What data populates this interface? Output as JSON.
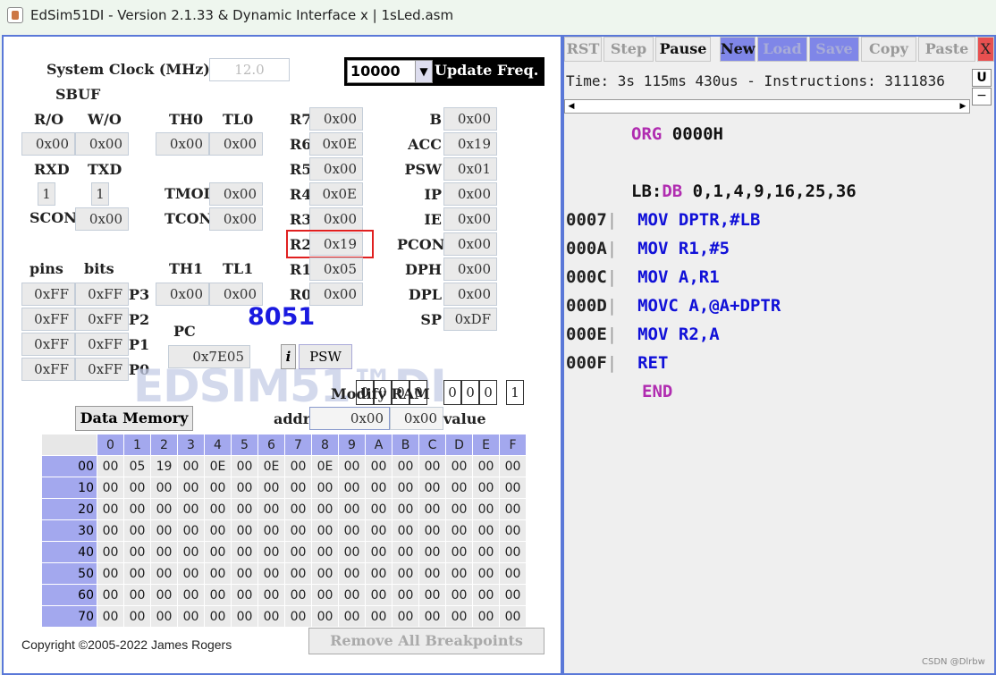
{
  "window": {
    "title": "EdSim51DI - Version 2.1.33 & Dynamic Interface x | 1sLed.asm"
  },
  "top": {
    "system_clock_label": "System Clock (MHz)",
    "system_clock_value": "12.0",
    "update_freq_value": "10000",
    "update_freq_label": "Update Freq.",
    "sbuf_label": "SBUF"
  },
  "serial": {
    "ro_label": "R/O",
    "wo_label": "W/O",
    "ro_value": "0x00",
    "wo_value": "0x00",
    "rxd_label": "RXD",
    "txd_label": "TXD",
    "rxd_value": "1",
    "txd_value": "1",
    "scon_label": "SCON",
    "scon_value": "0x00"
  },
  "timers": {
    "th0_label": "TH0",
    "tl0_label": "TL0",
    "th0_value": "0x00",
    "tl0_value": "0x00",
    "tmod_label": "TMOD",
    "tmod_value": "0x00",
    "tcon_label": "TCON",
    "tcon_value": "0x00",
    "th1_label": "TH1",
    "tl1_label": "TL1",
    "th1_value": "0x00",
    "tl1_value": "0x00"
  },
  "registers": [
    {
      "name": "R7",
      "value": "0x00"
    },
    {
      "name": "R6",
      "value": "0x0E"
    },
    {
      "name": "R5",
      "value": "0x00"
    },
    {
      "name": "R4",
      "value": "0x0E"
    },
    {
      "name": "R3",
      "value": "0x00"
    },
    {
      "name": "R2",
      "value": "0x19"
    },
    {
      "name": "R1",
      "value": "0x05"
    },
    {
      "name": "R0",
      "value": "0x00"
    }
  ],
  "sfr": [
    {
      "name": "B",
      "value": "0x00"
    },
    {
      "name": "ACC",
      "value": "0x19"
    },
    {
      "name": "PSW",
      "value": "0x01"
    },
    {
      "name": "IP",
      "value": "0x00"
    },
    {
      "name": "IE",
      "value": "0x00"
    },
    {
      "name": "PCON",
      "value": "0x00"
    },
    {
      "name": "DPH",
      "value": "0x00"
    },
    {
      "name": "DPL",
      "value": "0x00"
    },
    {
      "name": "SP",
      "value": "0xDF"
    }
  ],
  "ports": {
    "pins_label": "pins",
    "bits_label": "bits",
    "rows": [
      {
        "name": "P3",
        "pins": "0xFF",
        "bits": "0xFF"
      },
      {
        "name": "P2",
        "pins": "0xFF",
        "bits": "0xFF"
      },
      {
        "name": "P1",
        "pins": "0xFF",
        "bits": "0xFF"
      },
      {
        "name": "P0",
        "pins": "0xFF",
        "bits": "0xFF"
      }
    ]
  },
  "chip": {
    "label": "8051",
    "pc_label": "PC",
    "pc_value": "0x7E05",
    "info_btn": "i",
    "psw_btn": "PSW",
    "psw_bits": [
      "0",
      "0",
      "0",
      "0",
      "0",
      "0",
      "0",
      "1"
    ],
    "logo": "EDSIM51™DI"
  },
  "modify_ram": {
    "title": "Modify RAM",
    "addr_label": "addr",
    "addr_value": "0x00",
    "value_value": "0x00",
    "value_label": "value",
    "data_memory_btn": "Data Memory"
  },
  "memory": {
    "cols": [
      "0",
      "1",
      "2",
      "3",
      "4",
      "5",
      "6",
      "7",
      "8",
      "9",
      "A",
      "B",
      "C",
      "D",
      "E",
      "F"
    ],
    "rows": [
      {
        "addr": "00",
        "cells": [
          "00",
          "05",
          "19",
          "00",
          "0E",
          "00",
          "0E",
          "00",
          "0E",
          "00",
          "00",
          "00",
          "00",
          "00",
          "00",
          "00"
        ]
      },
      {
        "addr": "10",
        "cells": [
          "00",
          "00",
          "00",
          "00",
          "00",
          "00",
          "00",
          "00",
          "00",
          "00",
          "00",
          "00",
          "00",
          "00",
          "00",
          "00"
        ]
      },
      {
        "addr": "20",
        "cells": [
          "00",
          "00",
          "00",
          "00",
          "00",
          "00",
          "00",
          "00",
          "00",
          "00",
          "00",
          "00",
          "00",
          "00",
          "00",
          "00"
        ]
      },
      {
        "addr": "30",
        "cells": [
          "00",
          "00",
          "00",
          "00",
          "00",
          "00",
          "00",
          "00",
          "00",
          "00",
          "00",
          "00",
          "00",
          "00",
          "00",
          "00"
        ]
      },
      {
        "addr": "40",
        "cells": [
          "00",
          "00",
          "00",
          "00",
          "00",
          "00",
          "00",
          "00",
          "00",
          "00",
          "00",
          "00",
          "00",
          "00",
          "00",
          "00"
        ]
      },
      {
        "addr": "50",
        "cells": [
          "00",
          "00",
          "00",
          "00",
          "00",
          "00",
          "00",
          "00",
          "00",
          "00",
          "00",
          "00",
          "00",
          "00",
          "00",
          "00"
        ]
      },
      {
        "addr": "60",
        "cells": [
          "00",
          "00",
          "00",
          "00",
          "00",
          "00",
          "00",
          "00",
          "00",
          "00",
          "00",
          "00",
          "00",
          "00",
          "00",
          "00"
        ]
      },
      {
        "addr": "70",
        "cells": [
          "00",
          "00",
          "00",
          "00",
          "00",
          "00",
          "00",
          "00",
          "00",
          "00",
          "00",
          "00",
          "00",
          "00",
          "00",
          "00"
        ]
      }
    ]
  },
  "footer": {
    "copyright": "Copyright ©2005-2022 James Rogers",
    "remove_bp": "Remove All Breakpoints"
  },
  "toolbar": {
    "rst": "RST",
    "step": "Step",
    "pause": "Pause",
    "new": "New",
    "load": "Load",
    "save": "Save",
    "copy": "Copy",
    "paste": "Paste",
    "close": "X"
  },
  "status": {
    "text": "Time: 3s 115ms 430us - Instructions: 3111836",
    "u_btn": "U",
    "minus_btn": "−"
  },
  "code": [
    {
      "addr": "",
      "label": "",
      "op": "ORG",
      "args": "0000H"
    },
    {
      "addr": "",
      "label": "LB:",
      "op": "DB",
      "args": "0,1,4,9,16,25,36"
    },
    {
      "addr": "0007",
      "label": "",
      "op": "MOV",
      "args": "DPTR,#LB"
    },
    {
      "addr": "000A",
      "label": "",
      "op": "MOV",
      "args": "R1,#5"
    },
    {
      "addr": "000C",
      "label": "",
      "op": "MOV",
      "args": "A,R1"
    },
    {
      "addr": "000D",
      "label": "",
      "op": "MOVC",
      "args": "A,@A+DPTR"
    },
    {
      "addr": "000E",
      "label": "",
      "op": "MOV",
      "args": "R2,A"
    },
    {
      "addr": "000F",
      "label": "",
      "op": "RET",
      "args": ""
    },
    {
      "addr": "",
      "label": "",
      "op": "END",
      "args": ""
    }
  ],
  "watermark": "CSDN @Dlrbw"
}
